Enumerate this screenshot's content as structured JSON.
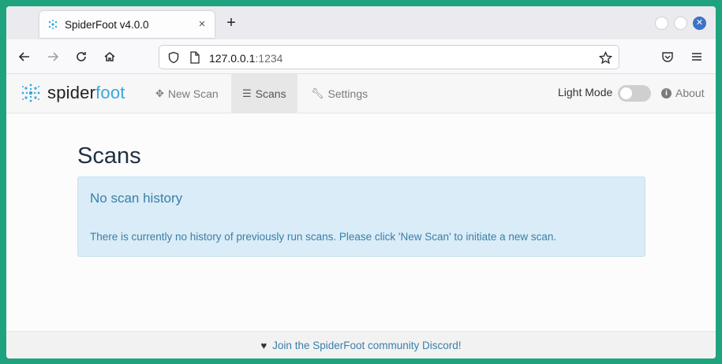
{
  "browser": {
    "tab_title": "SpiderFoot v4.0.0",
    "tab_close": "×",
    "new_tab": "+",
    "url_host": "127.0.0.1",
    "url_port": ":1234",
    "icons": [
      "back-icon",
      "forward-icon",
      "reload-icon",
      "home-icon",
      "shield-icon",
      "page-icon",
      "star-icon",
      "pocket-icon",
      "menu-icon"
    ]
  },
  "app": {
    "logo_spider": "spider",
    "logo_foot": "foot",
    "brand_color": "#3ba6dd",
    "nav": {
      "new_scan": "New Scan",
      "scans": "Scans",
      "settings": "Settings",
      "light_mode": "Light Mode",
      "about": "About"
    },
    "title": "Scans",
    "alert": {
      "title": "No scan history",
      "text": "There is currently no history of previously run scans. Please click 'New Scan' to initiate a new scan."
    },
    "footer": "Join the SpiderFoot community Discord!"
  }
}
